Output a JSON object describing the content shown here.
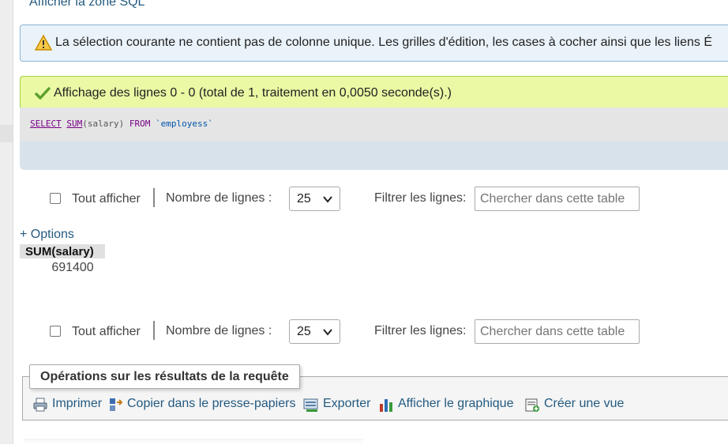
{
  "sql_toggle_link": "Afficher la zone SQL",
  "notice": {
    "text": "La sélection courante ne contient pas de colonne unique. Les grilles d'édition, les cases à cocher ainsi que les liens É"
  },
  "success": {
    "text": "Affichage des lignes 0 - 0 (total de 1, traitement en 0,0050 seconde(s).)"
  },
  "sql_query": {
    "select": "SELECT",
    "func": "SUM",
    "args": "(salary)",
    "from": "FROM",
    "table": "`employess`"
  },
  "nav": {
    "show_all_label": "Tout afficher",
    "rows_label": "Nombre de lignes :",
    "rows_value": "25",
    "filter_label": "Filtrer les lignes:",
    "filter_placeholder": "Chercher dans cette table"
  },
  "options_link": "+ Options",
  "results": {
    "columns": [
      "SUM(salary)"
    ],
    "rows": [
      [
        "691400"
      ]
    ]
  },
  "operations": {
    "legend": "Opérations sur les résultats de la requête",
    "print": "Imprimer",
    "copy": "Copier dans le presse-papiers",
    "export": "Exporter",
    "chart": "Afficher le graphique",
    "create_view": "Créer une vue"
  },
  "colors": {
    "link": "#235a81",
    "notice_bg": "#eaf3fa",
    "success_bg": "#ebf8a4",
    "sql_bg": "#e5e5e5"
  }
}
